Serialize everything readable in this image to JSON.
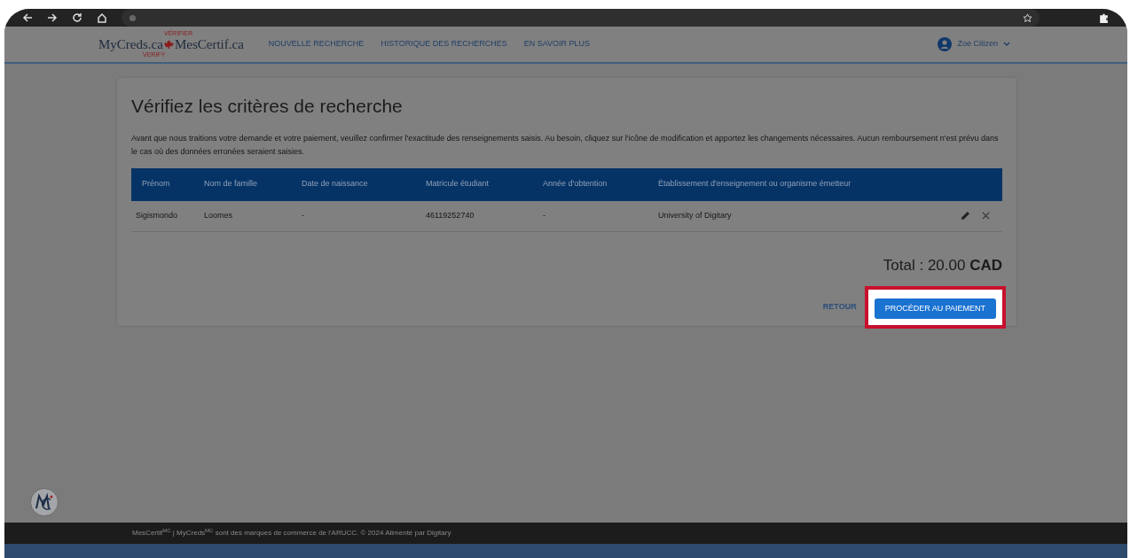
{
  "header": {
    "logo": {
      "left": "MyCreds.ca",
      "right": "MesCertif.ca",
      "over": "VÉRIFIER",
      "under": "VERIFY"
    },
    "nav": [
      "NOUVELLE RECHERCHE",
      "HISTORIQUE DES RECHERCHES",
      "EN SAVOIR PLUS"
    ],
    "user": {
      "name": "Zoe Citizen"
    }
  },
  "card": {
    "title": "Vérifiez les critères de recherche",
    "intro": "Avant que nous traitions votre demande et votre paiement, veuillez confirmer l'exactitude des renseignements saisis. Au besoin, cliquez sur l'icône de modification et apportez les changements nécessaires. Aucun remboursement n'est prévu dans le cas où des données erronées seraient saisies.",
    "table": {
      "columns": [
        "Prénom",
        "Nom de famille",
        "Date de naissance",
        "Matricule étudiant",
        "Année d'obtention",
        "Établissement d'enseignement ou organisme émetteur"
      ],
      "rows": [
        {
          "cells": [
            "Sigismondo",
            "Loomes",
            "-",
            "46119252740",
            "-",
            "University of Digitary"
          ]
        }
      ]
    },
    "total": "Total : 20.00 **CAD**",
    "back": "RETOUR",
    "pay": "PROCÉDER AU PAIEMENT",
    "pay_highlighted": true
  },
  "footer": "MesCertif$^{MC}$ | MyCreds$^{MC}$ sont des marques de commerce de l'ARUCC. © 2024 Alimenté par Digitary"
}
